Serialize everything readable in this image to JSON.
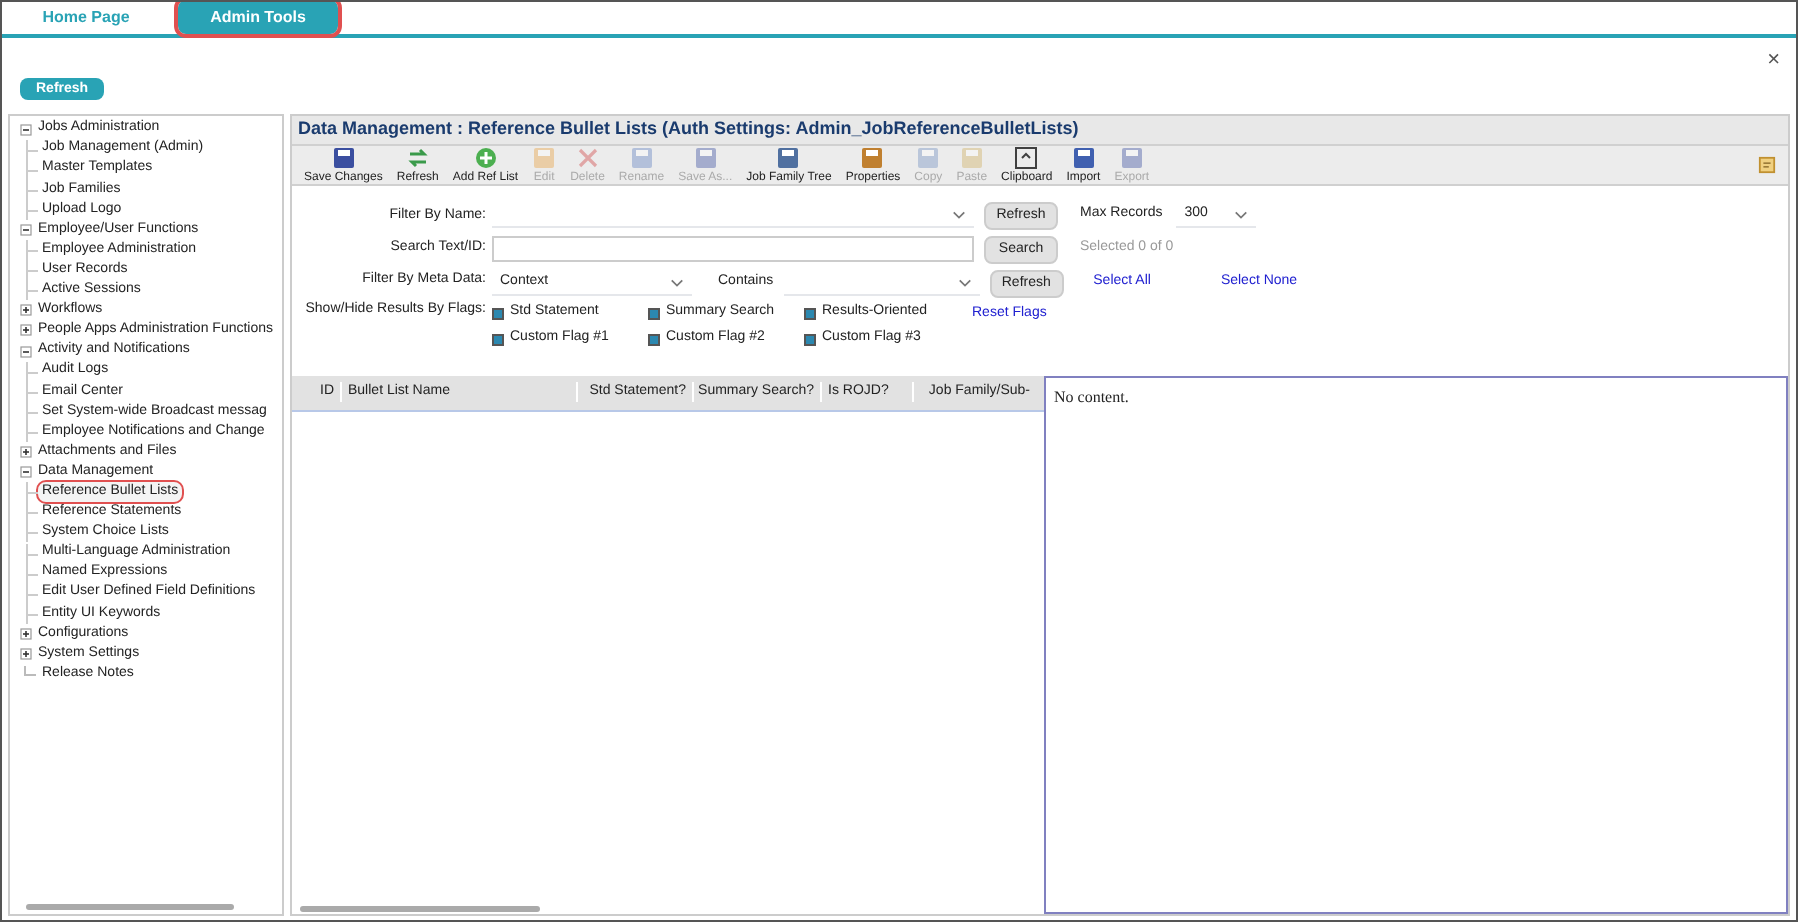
{
  "tabs": [
    {
      "label": "Home Page",
      "selected": false
    },
    {
      "label": "Admin Tools",
      "selected": true
    }
  ],
  "close": "×",
  "refresh_button": "Refresh",
  "tree": [
    {
      "label": "Jobs Administration",
      "expanded": true,
      "children": [
        {
          "label": "Job Management (Admin)",
          "selected": false
        },
        {
          "label": "Master Templates",
          "selected": false
        },
        {
          "label": "Job Families",
          "selected": false
        },
        {
          "label": "Upload Logo",
          "selected": false
        }
      ]
    },
    {
      "label": "Employee/User Functions",
      "expanded": true,
      "children": [
        {
          "label": "Employee Administration",
          "selected": false
        },
        {
          "label": "User Records",
          "selected": false
        },
        {
          "label": "Active Sessions",
          "selected": false
        }
      ]
    },
    {
      "label": "Workflows",
      "expanded": false
    },
    {
      "label": "People Apps Administration Functions",
      "expanded": false
    },
    {
      "label": "Activity and Notifications",
      "expanded": true,
      "children": [
        {
          "label": "Audit Logs",
          "selected": false
        },
        {
          "label": "Email Center",
          "selected": false
        },
        {
          "label": "Set System-wide Broadcast messag",
          "selected": false
        },
        {
          "label": "Employee Notifications and Change",
          "selected": false
        }
      ]
    },
    {
      "label": "Attachments and Files",
      "expanded": false
    },
    {
      "label": "Data Management",
      "expanded": true,
      "children": [
        {
          "label": "Reference Bullet Lists",
          "selected": true
        },
        {
          "label": "Reference Statements",
          "selected": false
        },
        {
          "label": "System Choice Lists",
          "selected": false
        },
        {
          "label": "Multi-Language Administration",
          "selected": false
        },
        {
          "label": "Named Expressions",
          "selected": false
        },
        {
          "label": "Edit User Defined Field Definitions",
          "selected": false
        },
        {
          "label": "Entity UI Keywords",
          "selected": false
        }
      ]
    },
    {
      "label": "Configurations",
      "expanded": false
    },
    {
      "label": "System Settings",
      "expanded": false
    },
    {
      "label": "Release Notes",
      "kind": "leaf"
    }
  ],
  "panel_title": "Data Management : Reference Bullet Lists (Auth Settings: Admin_JobReferenceBulletLists)",
  "toolbar": [
    {
      "label": "Save Changes",
      "disabled": false
    },
    {
      "label": "Refresh",
      "disabled": false
    },
    {
      "label": "Add Ref List",
      "disabled": false
    },
    {
      "label": "Edit",
      "disabled": true
    },
    {
      "label": "Delete",
      "disabled": true
    },
    {
      "label": "Rename",
      "disabled": true
    },
    {
      "label": "Save As...",
      "disabled": true
    },
    {
      "label": "Job Family Tree",
      "disabled": false
    },
    {
      "label": "Properties",
      "disabled": false
    },
    {
      "label": "Copy",
      "disabled": true
    },
    {
      "label": "Paste",
      "disabled": true
    },
    {
      "label": "Clipboard",
      "disabled": false
    },
    {
      "label": "Import",
      "disabled": false
    },
    {
      "label": "Export",
      "disabled": true
    }
  ],
  "filter_by_name": {
    "label": "Filter By Name:",
    "button": "Refresh"
  },
  "max_records": {
    "label": "Max Records",
    "value": "300"
  },
  "search": {
    "label": "Search Text/ID:",
    "button": "Search"
  },
  "selected_count": "Selected 0 of 0",
  "meta": {
    "label": "Filter By Meta Data:",
    "value": "Context",
    "operator": "Contains",
    "button": "Refresh"
  },
  "select_all": "Select All",
  "select_none": "Select None",
  "flags": {
    "label": "Show/Hide Results By Flags:",
    "items": [
      {
        "label": "Std Statement",
        "checked": true
      },
      {
        "label": "Summary Search",
        "checked": true
      },
      {
        "label": "Results-Oriented",
        "checked": true
      },
      {
        "label": "Custom Flag #1",
        "checked": true
      },
      {
        "label": "Custom Flag #2",
        "checked": true
      },
      {
        "label": "Custom Flag #3",
        "checked": true
      }
    ],
    "reset": "Reset Flags"
  },
  "table": {
    "columns": [
      "ID",
      "Bullet List Name",
      "Std Statement?",
      "Summary Search?",
      "Is ROJD?",
      "Job Family/Sub-"
    ]
  },
  "preview": "No content."
}
